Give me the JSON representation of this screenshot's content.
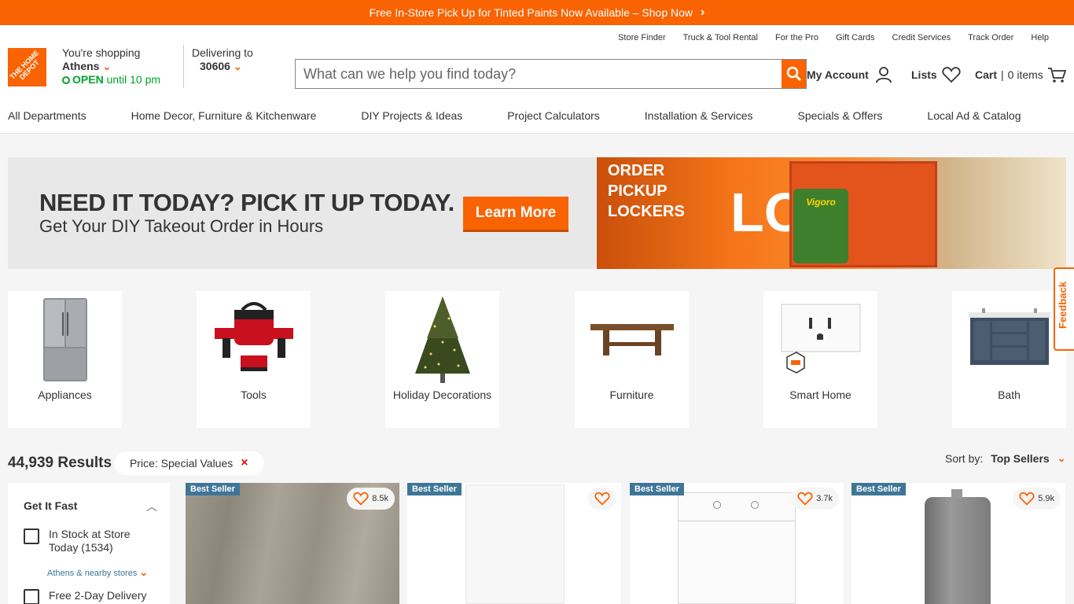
{
  "promo": {
    "text": "Free In-Store Pick Up for Tinted Paints Now Available – Shop Now",
    "chevron": "›"
  },
  "brand": {
    "logo_text": "THE HOME DEPOT",
    "accent": "#f96302"
  },
  "store": {
    "label": "You're shopping",
    "city": "Athens",
    "open": "OPEN",
    "hours": "until 10 pm"
  },
  "delivery": {
    "label": "Delivering to",
    "zip": "30606"
  },
  "utility_links": [
    "Store Finder",
    "Truck & Tool Rental",
    "For the Pro",
    "Gift Cards",
    "Credit Services",
    "Track Order",
    "Help"
  ],
  "search": {
    "placeholder": "What can we help you find today?",
    "icon": "search-icon"
  },
  "account": {
    "label": "My Account",
    "icon": "user-icon"
  },
  "lists": {
    "label": "Lists",
    "icon": "heart-icon"
  },
  "cart": {
    "label": "Cart",
    "count": "0 items",
    "icon": "cart-icon"
  },
  "nav": [
    "All Departments",
    "Home Decor, Furniture & Kitchenware",
    "DIY Projects & Ideas",
    "Project Calculators",
    "Installation & Services",
    "Specials & Offers",
    "Local Ad & Catalog"
  ],
  "hero": {
    "headline": "NEED IT TODAY? PICK IT UP TODAY.",
    "subhead": "Get Your DIY Takeout Order in Hours",
    "cta": "Learn More",
    "locker_text": "ORDER PICKUP LOCKERS",
    "locker_big": "LO",
    "bag_label": "Vigoro"
  },
  "categories": [
    {
      "label": "Appliances",
      "icon": "refrigerator-icon"
    },
    {
      "label": "Tools",
      "icon": "drill-kit-icon"
    },
    {
      "label": "Holiday Decorations",
      "icon": "christmas-tree-icon"
    },
    {
      "label": "Furniture",
      "icon": "table-icon"
    },
    {
      "label": "Smart Home",
      "icon": "smart-outlet-icon"
    },
    {
      "label": "Bath",
      "icon": "vanity-icon"
    }
  ],
  "feedback": {
    "label": "Feedback"
  },
  "results": {
    "count": "44,939 Results",
    "filter_pill": "Price: Special Values",
    "remove": "×"
  },
  "sort": {
    "label": "Sort by:",
    "value": "Top Sellers"
  },
  "filter": {
    "title": "Get It Fast",
    "options": [
      "In Stock at Store Today (1534)",
      "Free 2-Day Delivery"
    ],
    "nearby": "Athens & nearby stores"
  },
  "products": [
    {
      "badge": "Best Seller",
      "likes": "8.5k",
      "kind": "wood-flooring"
    },
    {
      "badge": "Best Seller",
      "likes": "",
      "kind": "freezer"
    },
    {
      "badge": "Best Seller",
      "likes": "3.7k",
      "kind": "washer"
    },
    {
      "badge": "Best Seller",
      "likes": "5.9k",
      "kind": "water-heater"
    }
  ]
}
